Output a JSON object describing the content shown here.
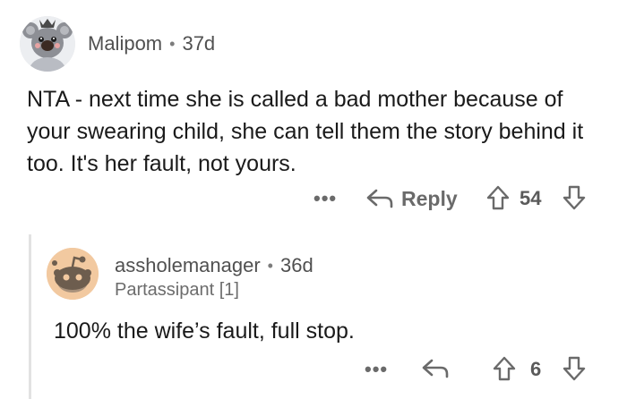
{
  "top_comment": {
    "author": "Malipom",
    "separator": "•",
    "age": "37d",
    "body": "NTA - next time she is called a bad mother because of your swearing child, she can tell them the story behind it too. It's her fault, not yours.",
    "more_label": "•••",
    "reply_label": "Reply",
    "score": "54"
  },
  "reply_comment": {
    "author": "assholemanager",
    "separator": "•",
    "age": "36d",
    "flair": "Partassipant [1]",
    "body": "100% the wife’s fault, full stop.",
    "more_label": "•••",
    "score": "6"
  },
  "icons": {
    "top_avatar": "koala-avatar-icon",
    "reply_avatar": "default-snoo-avatar-icon",
    "reply": "reply-arrow-icon",
    "upvote": "upvote-arrow-icon",
    "downvote": "downvote-arrow-icon"
  },
  "colors": {
    "reply_avatar_bg": "#f2c9a0",
    "text": "#1a1a1a",
    "meta": "#505050",
    "action": "#6a6a6a"
  }
}
